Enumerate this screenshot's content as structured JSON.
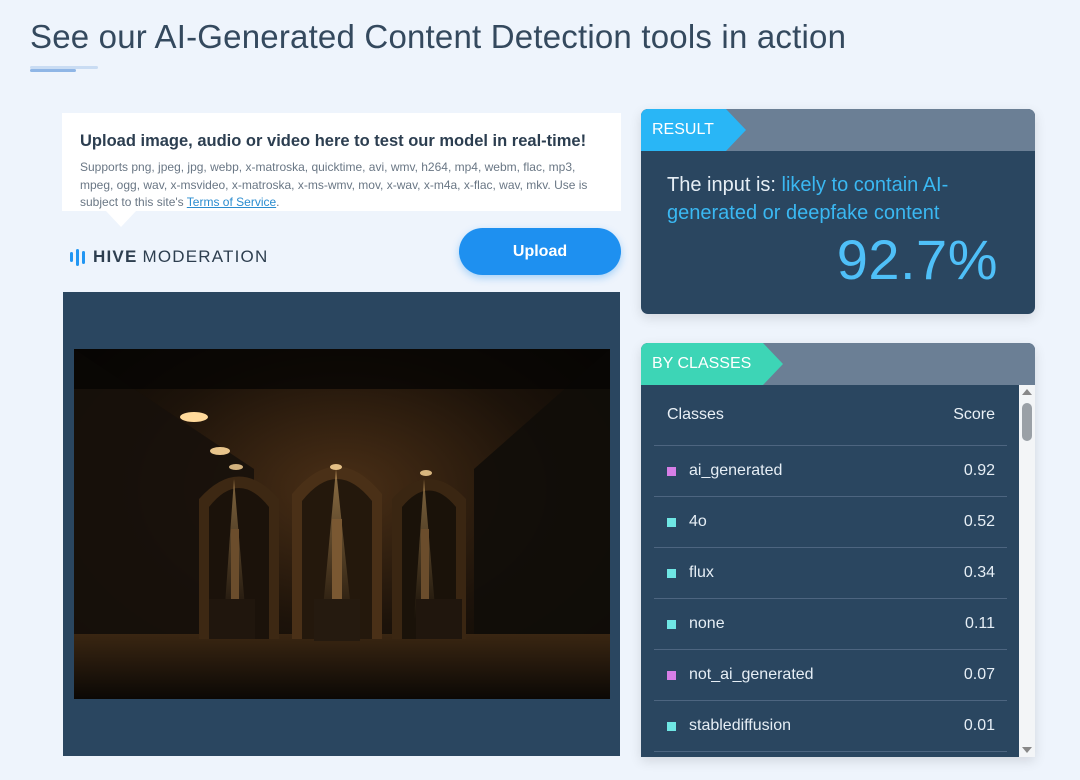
{
  "page": {
    "title": "See our AI-Generated Content Detection tools in action"
  },
  "upload": {
    "heading": "Upload image, audio or video here to test our model in real-time!",
    "description": "Supports png, jpeg, jpg, webp, x-matroska, quicktime, avi, wmv, h264, mp4, webm, flac, mp3, mpeg, ogg, wav, x-msvideo, x-matroska, x-ms-wmv, mov, x-wav, x-m4a, x-flac, wav, mkv. Use is subject to this site's ",
    "tos_link": "Terms of Service",
    "tos_suffix": ".",
    "button_label": "Upload"
  },
  "brand": {
    "name_bold": "HIVE",
    "name_rest": "MODERATION",
    "accent_color": "#2196f3"
  },
  "result": {
    "tag": "RESULT",
    "prefix": "The input is: ",
    "verdict": "likely to contain AI-generated or deepfake content",
    "percent": "92.7%"
  },
  "classes": {
    "tag": "BY CLASSES",
    "column_class": "Classes",
    "column_score": "Score",
    "rows": [
      {
        "name": "ai_generated",
        "score": "0.92",
        "color": "#d67ee6"
      },
      {
        "name": "4o",
        "score": "0.52",
        "color": "#6fe6e4"
      },
      {
        "name": "flux",
        "score": "0.34",
        "color": "#6fe6e4"
      },
      {
        "name": "none",
        "score": "0.11",
        "color": "#6fe6e4"
      },
      {
        "name": "not_ai_generated",
        "score": "0.07",
        "color": "#d67ee6"
      },
      {
        "name": "stablediffusion",
        "score": "0.01",
        "color": "#6fe6e4"
      }
    ]
  },
  "icons": {
    "brand_logo": "hive-bars-icon",
    "scroll_up": "arrow-up-icon",
    "scroll_down": "arrow-down-icon"
  }
}
